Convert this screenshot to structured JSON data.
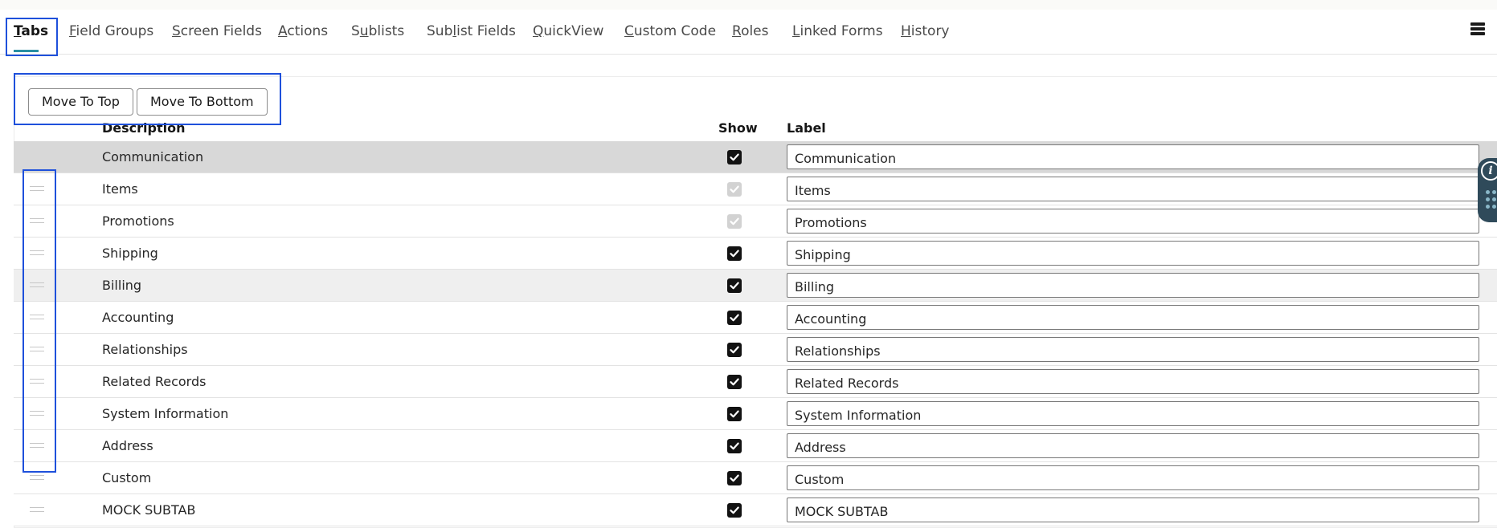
{
  "tabs": [
    {
      "pre": "",
      "key": "T",
      "post": "abs",
      "active": true
    },
    {
      "pre": "",
      "key": "F",
      "post": "ield Groups",
      "active": false
    },
    {
      "pre": "",
      "key": "S",
      "post": "creen Fields",
      "active": false
    },
    {
      "pre": "",
      "key": "A",
      "post": "ctions",
      "active": false
    },
    {
      "pre": "S",
      "key": "u",
      "post": "blists",
      "active": false
    },
    {
      "pre": "Sub",
      "key": "l",
      "post": "ist Fields",
      "active": false
    },
    {
      "pre": "",
      "key": "Q",
      "post": "uickView",
      "active": false
    },
    {
      "pre": "",
      "key": "C",
      "post": "ustom Code",
      "active": false
    },
    {
      "pre": "",
      "key": "R",
      "post": "oles",
      "active": false
    },
    {
      "pre": "",
      "key": "L",
      "post": "inked Forms",
      "active": false
    },
    {
      "pre": "",
      "key": "H",
      "post": "istory",
      "active": false
    }
  ],
  "buttons": {
    "move_to_top": "Move To Top",
    "move_to_bottom": "Move To Bottom"
  },
  "columns": {
    "description": "Description",
    "show": "Show",
    "label": "Label"
  },
  "rows": [
    {
      "description": "Communication",
      "show": true,
      "show_disabled": false,
      "label": "Communication",
      "state": "selected",
      "drag": false
    },
    {
      "description": "Items",
      "show": true,
      "show_disabled": true,
      "label": "Items",
      "state": "",
      "drag": true
    },
    {
      "description": "Promotions",
      "show": true,
      "show_disabled": true,
      "label": "Promotions",
      "state": "",
      "drag": true
    },
    {
      "description": "Shipping",
      "show": true,
      "show_disabled": false,
      "label": "Shipping",
      "state": "",
      "drag": true
    },
    {
      "description": "Billing",
      "show": true,
      "show_disabled": false,
      "label": "Billing",
      "state": "hover",
      "drag": true
    },
    {
      "description": "Accounting",
      "show": true,
      "show_disabled": false,
      "label": "Accounting",
      "state": "",
      "drag": true
    },
    {
      "description": "Relationships",
      "show": true,
      "show_disabled": false,
      "label": "Relationships",
      "state": "",
      "drag": true
    },
    {
      "description": "Related Records",
      "show": true,
      "show_disabled": false,
      "label": "Related Records",
      "state": "",
      "drag": true
    },
    {
      "description": "System Information",
      "show": true,
      "show_disabled": false,
      "label": "System Information",
      "state": "",
      "drag": true
    },
    {
      "description": "Address",
      "show": true,
      "show_disabled": false,
      "label": "Address",
      "state": "",
      "drag": true
    },
    {
      "description": "Custom",
      "show": true,
      "show_disabled": false,
      "label": "Custom",
      "state": "",
      "drag": true
    },
    {
      "description": "MOCK SUBTAB",
      "show": true,
      "show_disabled": false,
      "label": "MOCK SUBTAB",
      "state": "",
      "drag": true
    }
  ],
  "icons": {
    "menu": "hamburger-menu-icon",
    "drag": "drag-handle-icon",
    "info": "info-icon",
    "check": "checkmark-icon"
  },
  "side_widget": {
    "info_glyph": "i"
  },
  "colors": {
    "accent": "#2a8fa3",
    "highlight_box": "#1e50db",
    "selected_row": "#d8d8d8",
    "checkbox": "#121212"
  }
}
